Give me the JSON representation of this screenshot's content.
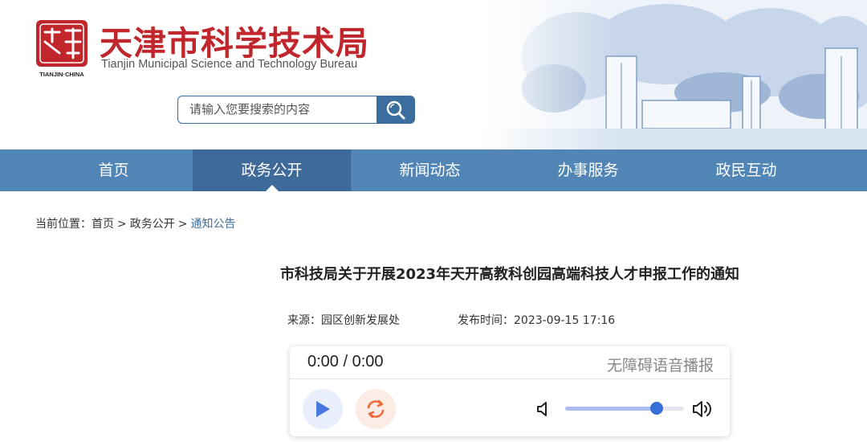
{
  "header": {
    "seal_text": "天津",
    "seal_caption": "TIANJIN·CHINA",
    "site_title": "天津市科学技术局",
    "site_title_en": "Tianjin Municipal Science and Technology Bureau",
    "search_placeholder": "请输入您要搜索的内容",
    "icons": {
      "search": "search-icon"
    },
    "colors": {
      "brand_red": "#c0262b",
      "brand_blue": "#3b6e9f"
    }
  },
  "nav": {
    "items": [
      {
        "label": "首页",
        "active": false
      },
      {
        "label": "政务公开",
        "active": true
      },
      {
        "label": "新闻动态",
        "active": false
      },
      {
        "label": "办事服务",
        "active": false
      },
      {
        "label": "政民互动",
        "active": false
      }
    ],
    "colors": {
      "bar": "#5085b6",
      "active": "#3d6a98"
    }
  },
  "breadcrumb": {
    "prefix": "当前位置：",
    "items": [
      "首页",
      "政务公开",
      "通知公告"
    ],
    "separator": ">"
  },
  "article": {
    "title": "市科技局关于开展2023年天开高教科创园高端科技人才申报工作的通知",
    "source_label": "来源：",
    "source": "园区创新发展处",
    "date_label": "发布时间：",
    "date": "2023-09-15 17:16"
  },
  "player": {
    "time": "0:00 / 0:00",
    "label": "无障碍语音播报",
    "volume": 0.77,
    "icons": {
      "play": "play-icon",
      "repeat": "repeat-icon",
      "volume_low": "volume-low-icon",
      "volume_high": "volume-high-icon"
    }
  }
}
